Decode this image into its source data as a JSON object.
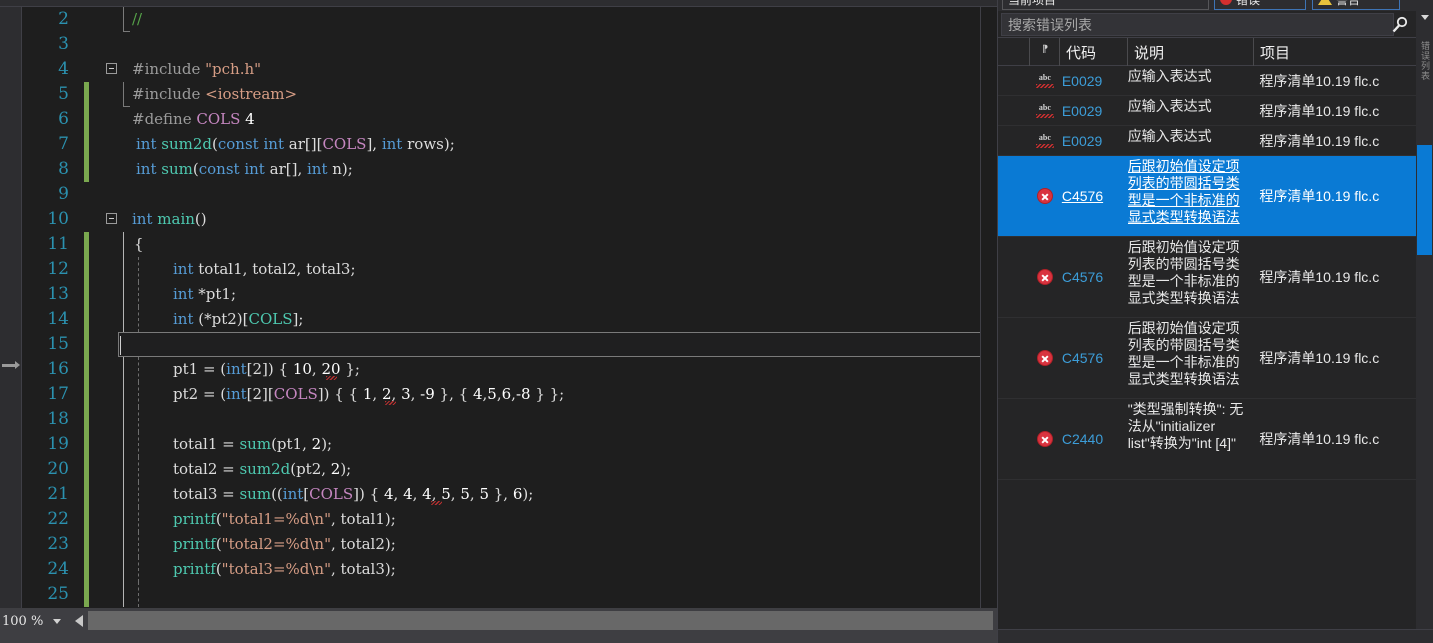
{
  "editor": {
    "zoom_level": "100 %",
    "lines": [
      {
        "n": "2",
        "modified": false,
        "indent_guide": false
      },
      {
        "n": "3",
        "modified": false,
        "indent_guide": false
      },
      {
        "n": "4",
        "modified": false,
        "indent_guide": false
      },
      {
        "n": "5",
        "modified": true,
        "indent_guide": false
      },
      {
        "n": "6",
        "modified": true,
        "indent_guide": false
      },
      {
        "n": "7",
        "modified": true,
        "indent_guide": false
      },
      {
        "n": "8",
        "modified": true,
        "indent_guide": false
      },
      {
        "n": "9",
        "modified": false,
        "indent_guide": false
      },
      {
        "n": "10",
        "modified": false,
        "indent_guide": false
      },
      {
        "n": "11",
        "modified": true,
        "indent_guide": false
      },
      {
        "n": "12",
        "modified": true,
        "indent_guide": true
      },
      {
        "n": "13",
        "modified": true,
        "indent_guide": true
      },
      {
        "n": "14",
        "modified": true,
        "indent_guide": true
      },
      {
        "n": "15",
        "modified": true,
        "indent_guide": true
      },
      {
        "n": "16",
        "modified": true,
        "indent_guide": true
      },
      {
        "n": "17",
        "modified": true,
        "indent_guide": true
      },
      {
        "n": "18",
        "modified": true,
        "indent_guide": true
      },
      {
        "n": "19",
        "modified": true,
        "indent_guide": true
      },
      {
        "n": "20",
        "modified": true,
        "indent_guide": true
      },
      {
        "n": "21",
        "modified": true,
        "indent_guide": true
      },
      {
        "n": "22",
        "modified": true,
        "indent_guide": true
      },
      {
        "n": "23",
        "modified": true,
        "indent_guide": true
      },
      {
        "n": "24",
        "modified": true,
        "indent_guide": true
      },
      {
        "n": "25",
        "modified": true,
        "indent_guide": true
      }
    ],
    "source_text": [
      "//",
      "",
      "#include \"pch.h\"",
      "#include <iostream>",
      "#define COLS 4",
      "int sum2d(const int ar[][COLS], int rows);",
      "int sum(const int ar[], int n);",
      "",
      "int main()",
      "{",
      "    int total1, total2, total3;",
      "    int *pt1;",
      "    int (*pt2)[COLS];",
      "",
      "    pt1 = (int[2]) { 10, 20 };",
      "    pt2 = (int[2][COLS]) { { 1, 2, 3, -9 }, { 4,5,6,-8 } };",
      "",
      "    total1 = sum(pt1, 2);",
      "    total2 = sum2d(pt2, 2);",
      "    total3 = sum((int[COLS]) { 4, 4, 4, 5, 5, 5 }, 6);",
      "    printf(\"total1=%d\\n\", total1);",
      "    printf(\"total2=%d\\n\", total2);",
      "    printf(\"total3=%d\\n\", total3);",
      ""
    ],
    "colors": {
      "background": "#1e1e1e",
      "line_number": "#2b91af",
      "keyword": "#569cd6",
      "function": "#4ec9b0",
      "macro": "#c586c0",
      "string": "#d69d85",
      "comment": "#57a64a",
      "number": "#b5cea8",
      "change_marker": "#7aa84f"
    }
  },
  "error_panel": {
    "toolbar": {
      "filter_label": "当前项目",
      "errors_label": "错误",
      "warnings_label": "警告"
    },
    "search": {
      "placeholder": "搜索错误列表",
      "icon": "search-icon",
      "dropdown_icon": "chevron-down-icon"
    },
    "columns": [
      "",
      "",
      "代码",
      "说明",
      "项目"
    ],
    "rows": [
      {
        "icon": "abc-squiggle-icon",
        "severity": "info",
        "code": "E0029",
        "description": "应输入表达式",
        "project": "程序清单10.19 flc.c",
        "selected": false
      },
      {
        "icon": "abc-squiggle-icon",
        "severity": "info",
        "code": "E0029",
        "description": "应输入表达式",
        "project": "程序清单10.19 flc.c",
        "selected": false
      },
      {
        "icon": "abc-squiggle-icon",
        "severity": "info",
        "code": "E0029",
        "description": "应输入表达式",
        "project": "程序清单10.19 flc.c",
        "selected": false
      },
      {
        "icon": "error-icon",
        "severity": "error",
        "code": "C4576",
        "description": "后跟初始值设定项列表的带圆括号类型是一个非标准的显式类型转换语法",
        "project": "程序清单10.19 flc.c",
        "selected": true
      },
      {
        "icon": "error-icon",
        "severity": "error",
        "code": "C4576",
        "description": "后跟初始值设定项列表的带圆括号类型是一个非标准的显式类型转换语法",
        "project": "程序清单10.19 flc.c",
        "selected": false
      },
      {
        "icon": "error-icon",
        "severity": "error",
        "code": "C4576",
        "description": "后跟初始值设定项列表的带圆括号类型是一个非标准的显式类型转换语法",
        "project": "程序清单10.19 flc.c",
        "selected": false
      },
      {
        "icon": "error-icon",
        "severity": "error",
        "code": "C2440",
        "description": "\"类型强制转换\": 无法从\"initializer list\"转换为\"int [4]\"",
        "project": "程序清单10.19 flc.c",
        "selected": false
      }
    ],
    "selection_color": "#0a7ad4",
    "error_icon_color": "#d9333f",
    "code_link_color": "#3c9dd8"
  }
}
